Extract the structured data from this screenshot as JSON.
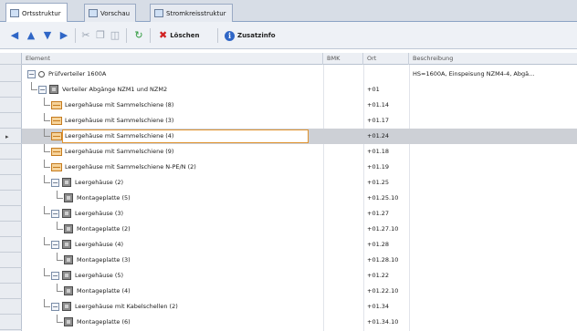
{
  "tabs": [
    {
      "label": "Ortsstruktur",
      "icon": "tree-structure-icon"
    },
    {
      "label": "Vorschau",
      "icon": "preview-icon"
    },
    {
      "label": "Stromkreisstruktur",
      "icon": "circuit-structure-icon"
    }
  ],
  "toolbar": {
    "loeschen_label": "Löschen",
    "zusatzinfo_label": "Zusatzinfo"
  },
  "columns": {
    "element": "Element",
    "bmk": "BMK",
    "ort": "Ort",
    "beschreibung": "Beschreibung"
  },
  "rows": [
    {
      "label": "Prüfverteiler 1600A",
      "ort": "",
      "desc": "HS=1600A, Einspeisung NZM4-4, Abgä...",
      "icon": "circle"
    },
    {
      "label": "Verteiler Abgänge NZM1 und NZM2",
      "ort": "+01",
      "desc": "",
      "icon": "gray"
    },
    {
      "label": "Leergehäuse mit Sammelschiene (8)",
      "ort": "+01.14",
      "desc": "",
      "icon": "orange"
    },
    {
      "label": "Leergehäuse mit Sammelschiene (3)",
      "ort": "+01.17",
      "desc": "",
      "icon": "orange"
    },
    {
      "label": "Leergehäuse mit Sammelschiene (4)",
      "ort": "+01.24",
      "desc": "",
      "icon": "orange"
    },
    {
      "label": "Leergehäuse mit Sammelschiene (9)",
      "ort": "+01.18",
      "desc": "",
      "icon": "orange"
    },
    {
      "label": "Leergehäuse mit Sammelschiene N-PE/N (2)",
      "ort": "+01.19",
      "desc": "",
      "icon": "orange"
    },
    {
      "label": "Leergehäuse (2)",
      "ort": "+01.25",
      "desc": "",
      "icon": "gray"
    },
    {
      "label": "Montageplatte (5)",
      "ort": "+01.25.10",
      "desc": "",
      "icon": "gray"
    },
    {
      "label": "Leergehäuse (3)",
      "ort": "+01.27",
      "desc": "",
      "icon": "gray"
    },
    {
      "label": "Montageplatte (2)",
      "ort": "+01.27.10",
      "desc": "",
      "icon": "gray"
    },
    {
      "label": "Leergehäuse (4)",
      "ort": "+01.28",
      "desc": "",
      "icon": "gray"
    },
    {
      "label": "Montageplatte (3)",
      "ort": "+01.28.10",
      "desc": "",
      "icon": "gray"
    },
    {
      "label": "Leergehäuse (5)",
      "ort": "+01.22",
      "desc": "",
      "icon": "gray"
    },
    {
      "label": "Montageplatte (4)",
      "ort": "+01.22.10",
      "desc": "",
      "icon": "gray"
    },
    {
      "label": "Leergehäuse mit Kabelschellen (2)",
      "ort": "+01.34",
      "desc": "",
      "icon": "gray"
    },
    {
      "label": "Montageplatte (6)",
      "ort": "+01.34.10",
      "desc": "",
      "icon": "gray"
    }
  ],
  "colors": {
    "selection": "#cdd0d6",
    "edit_border": "#e0932e",
    "accent": "#2f66c6"
  }
}
